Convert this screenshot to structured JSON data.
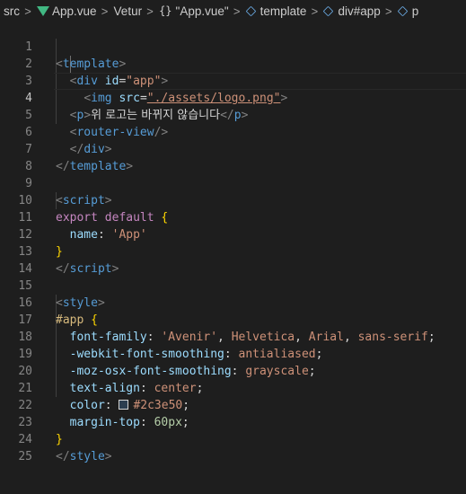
{
  "breadcrumb": {
    "items": [
      "src",
      "App.vue",
      "Vetur",
      "\"App.vue\"",
      "template",
      "div#app",
      "p"
    ],
    "separator": ">",
    "braces_glyph": "{}"
  },
  "editor": {
    "line_numbers": [
      "1",
      "2",
      "3",
      "4",
      "5",
      "6",
      "7",
      "8",
      "9",
      "10",
      "11",
      "12",
      "13",
      "14",
      "15",
      "16",
      "17",
      "18",
      "19",
      "20",
      "21",
      "22",
      "23",
      "24",
      "25"
    ],
    "active_line": "4",
    "lines": {
      "l1": {
        "open": "<",
        "tag": "template",
        "close": ">"
      },
      "l2": {
        "open": "<",
        "tag": "div",
        "attr": "id",
        "eq": "=",
        "value": "\"app\"",
        "close": ">"
      },
      "l3": {
        "open": "<",
        "tag": "img",
        "attr": "src",
        "eq": "=",
        "value": "\"./assets/logo.png\"",
        "close": ">"
      },
      "l4": {
        "open": "<",
        "tag": "p",
        "close": ">",
        "text": "위 로고는 바뀌지 않습니다",
        "end_open": "</",
        "end_tag": "p",
        "end_close": ">"
      },
      "l5": {
        "open": "<",
        "tag": "router-view",
        "close": "/>"
      },
      "l6": {
        "open": "</",
        "tag": "div",
        "close": ">"
      },
      "l7": {
        "open": "</",
        "tag": "template",
        "close": ">"
      },
      "l9": {
        "open": "<",
        "tag": "script",
        "close": ">"
      },
      "l10": {
        "kw1": "export",
        "kw2": "default",
        "brace": "{"
      },
      "l11": {
        "prop": "name",
        "colon": ":",
        "value": "'App'"
      },
      "l12": {
        "brace": "}"
      },
      "l13": {
        "open": "</",
        "tag": "script",
        "close": ">"
      },
      "l15": {
        "open": "<",
        "tag": "style",
        "close": ">"
      },
      "l16": {
        "selector": "#app",
        "brace": "{"
      },
      "l17": {
        "prop": "font-family",
        "colon": ":",
        "v1": "'Avenir'",
        "c1": ",",
        "v2": "Helvetica",
        "c2": ",",
        "v3": "Arial",
        "c3": ",",
        "v4": "sans-serif",
        "semi": ";"
      },
      "l18": {
        "prop": "-webkit-font-smoothing",
        "colon": ":",
        "value": "antialiased",
        "semi": ";"
      },
      "l19": {
        "prop": "-moz-osx-font-smoothing",
        "colon": ":",
        "value": "grayscale",
        "semi": ";"
      },
      "l20": {
        "prop": "text-align",
        "colon": ":",
        "value": "center",
        "semi": ";"
      },
      "l21": {
        "prop": "color",
        "colon": ":",
        "value": "#2c3e50",
        "semi": ";"
      },
      "l22": {
        "prop": "margin-top",
        "colon": ":",
        "value": "60px",
        "semi": ";"
      },
      "l23": {
        "brace": "}"
      },
      "l24": {
        "open": "</",
        "tag": "style",
        "close": ">"
      }
    }
  },
  "colors": {
    "background": "#1e1e1e",
    "swatch": "#2c3e50",
    "vue_green": "#41b883"
  }
}
